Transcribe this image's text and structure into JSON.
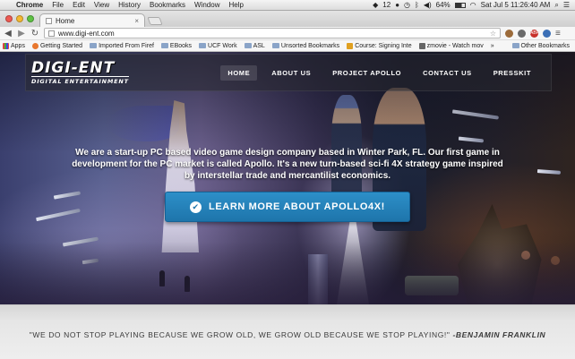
{
  "menubar": {
    "app_name": "Chrome",
    "items": [
      "File",
      "Edit",
      "View",
      "History",
      "Bookmarks",
      "Window",
      "Help"
    ],
    "status": {
      "dropbox_count": "12",
      "battery": "64%",
      "datetime": "Sat Jul 5  11:26:40 AM"
    }
  },
  "tab": {
    "title": "Home",
    "close_glyph": "×"
  },
  "toolbar": {
    "url": "www.digi-ent.com",
    "back_glyph": "◀",
    "forward_glyph": "▶",
    "reload_glyph": "↻",
    "star_glyph": "☆",
    "menu_glyph": "≡",
    "extension_label": "ABP"
  },
  "bookmarks": {
    "items": [
      "Apps",
      "Getting Started",
      "Imported From Firef",
      "EBooks",
      "UCF Work",
      "ASL",
      "Unsorted Bookmarks",
      "Course: Signing Inte",
      "zmovie - Watch mov"
    ],
    "other": "Other Bookmarks",
    "more_glyph": "»"
  },
  "site": {
    "logo_main": "DIGI-ENT",
    "logo_sub": "DIGITAL ENTERTAINMENT",
    "nav": [
      "HOME",
      "ABOUT US",
      "PROJECT APOLLO",
      "CONTACT US",
      "PRESSKIT"
    ],
    "tagline": "We are a start-up PC based video game design company based in Winter Park, FL. Our first game in development for the PC market is called Apollo. It's a new turn-based sci-fi 4X strategy game inspired by interstellar trade and mercantilist economics.",
    "cta_label": "LEARN MORE ABOUT APOLLO4X!",
    "quote": "\"WE DO NOT STOP PLAYING BECAUSE WE GROW OLD, WE GROW OLD BECAUSE WE STOP PLAYING!\"",
    "quote_author": "-BENJAMIN FRANKLIN"
  },
  "colors": {
    "cta": "#2d8fc8",
    "nav_bg": "#28282f",
    "close_red": "#ee5a52",
    "minimize_yellow": "#f4b932",
    "zoom_green": "#5ec244"
  }
}
